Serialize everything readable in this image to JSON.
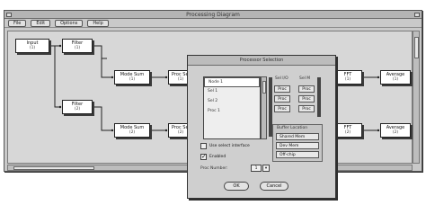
{
  "window": {
    "title": "Processing Diagram",
    "menus": [
      "File",
      "Edit",
      "Options",
      "Help"
    ]
  },
  "diagram": {
    "nodes": [
      {
        "id": "n1",
        "title": "Input",
        "sub": "(1)"
      },
      {
        "id": "n2",
        "title": "Filter",
        "sub": "(1)"
      },
      {
        "id": "n3",
        "title": "Filter",
        "sub": "(2)"
      },
      {
        "id": "n4",
        "title": "Mode Sum",
        "sub": "(1)"
      },
      {
        "id": "n5",
        "title": "Mode Sum",
        "sub": "(2)"
      },
      {
        "id": "n6",
        "title": "Proc Sel",
        "sub": "(1)"
      },
      {
        "id": "n7",
        "title": "Proc Sel",
        "sub": "(2)"
      },
      {
        "id": "n8",
        "title": "FFT",
        "sub": "(1)"
      },
      {
        "id": "n9",
        "title": "FFT",
        "sub": "(2)"
      },
      {
        "id": "n10",
        "title": "Average",
        "sub": "(1)"
      },
      {
        "id": "n11",
        "title": "Average",
        "sub": "(2)"
      }
    ]
  },
  "dialog": {
    "title": "Processor Selection",
    "list_items": [
      "Node 1",
      "Sel 1",
      "Sel 2",
      "Proc 1"
    ],
    "group1_label": "Sel I/O",
    "group2_label": "Sel M",
    "group1_buttons": [
      "Proc",
      "Proc",
      "Proc"
    ],
    "group2_buttons": [
      "Proc",
      "Proc",
      "Proc"
    ],
    "options_title": "Buffer Location",
    "options": [
      "Shared Mem",
      "Dev Mem",
      "Off-chip"
    ],
    "check1_label": "Use select interface",
    "check1_checked": false,
    "check2_label": "Enabled",
    "check2_checked": true,
    "proc_label": "Proc Number:",
    "proc_value": "1",
    "ok_label": "OK",
    "cancel_label": "Cancel"
  }
}
